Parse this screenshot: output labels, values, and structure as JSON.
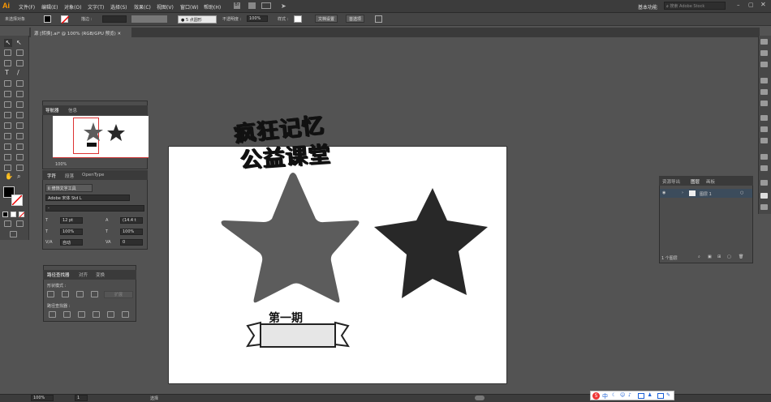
{
  "app": {
    "logo": "Ai"
  },
  "menubar": {
    "items": [
      "文件(F)",
      "编辑(E)",
      "对象(O)",
      "文字(T)",
      "选择(S)",
      "效果(C)",
      "视图(V)",
      "窗口(W)",
      "帮助(H)"
    ],
    "workspace": "基本功能",
    "search_placeholder": "搜索 Adobe Stock"
  },
  "controlbar": {
    "selection": "未选择对象",
    "stroke_label": "描边 :",
    "brush": "5 点圆形",
    "opacity_label": "不透明度 :",
    "opacity": "100%",
    "style_label": "样式 :",
    "doc_setup": "文档设置",
    "preferences": "首选项"
  },
  "document": {
    "tab": "源 [转换].ai* @ 100% (RGB/GPU 预览)"
  },
  "navigator": {
    "tabs": [
      "导航器",
      "信息"
    ],
    "zoom": "100%"
  },
  "character": {
    "tabs": [
      "字符",
      "段落",
      "OpenType"
    ],
    "touch_type": "修饰文字工具",
    "font": "Adobe 宋体 Std L",
    "style": "-",
    "size": "12 pt",
    "leading": "(14.4 t",
    "scale_v": "100%",
    "scale_h": "100%",
    "kerning": "自动",
    "tracking": "0"
  },
  "pathfinder": {
    "tabs": [
      "路径查找器",
      "对齐",
      "变换"
    ],
    "shape_modes": "形状模式 :",
    "pathfinders": "路径查找器 :",
    "expand": "扩展"
  },
  "layers": {
    "tabs": [
      "资源导出",
      "图层",
      "画板"
    ],
    "layer_name": "图层 1",
    "count": "1 个图层"
  },
  "artwork": {
    "title_line1": "疯狂记忆",
    "title_line2": "公益课堂",
    "issue": "第一期",
    "colors": {
      "star_gray": "#5c5c5c",
      "star_dark": "#282828"
    }
  },
  "statusbar": {
    "zoom": "100%",
    "page": "1",
    "tool": "选择"
  }
}
